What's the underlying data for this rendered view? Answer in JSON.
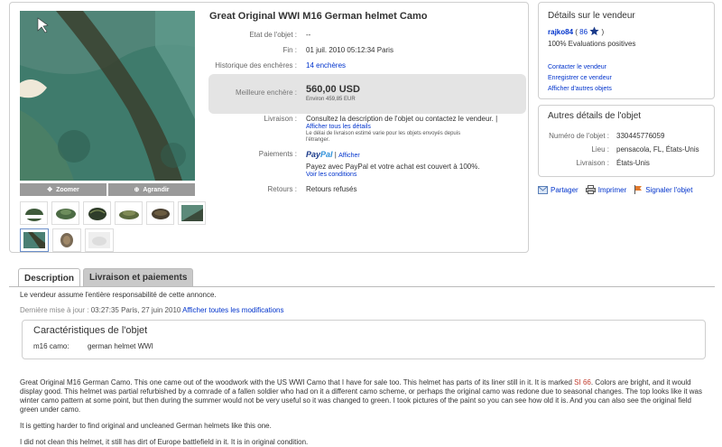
{
  "item": {
    "title": "Great Original WWI M16 German helmet Camo",
    "zoom_label": "Zoomer",
    "enlarge_label": "Agrandir",
    "condition_label": "Etat de l'objet :",
    "condition_value": "--",
    "end_label": "Fin :",
    "end_value": "01 juil. 2010 05:12:34 Paris",
    "history_label": "Historique des enchères :",
    "history_value": "14 enchères",
    "best_bid_label": "Meilleure enchère :",
    "best_bid_value": "560,00 USD",
    "best_bid_approx": "Environ 459,85 EUR",
    "delivery_label": "Livraison :",
    "delivery_value": "Consultez la description de l'objet ou contactez le vendeur.",
    "delivery_sep": "|",
    "delivery_link": "Afficher tous les détails",
    "delivery_note_1": "Le délai de livraison estimé varie pour les objets envoyés depuis",
    "delivery_note_2": "l'étranger.",
    "payments_label": "Paiements :",
    "paypal_part1": "Pay",
    "paypal_part2": "Pal",
    "paypal_sep": "|",
    "paypal_show": "Afficher",
    "paypal_text": "Payez avec PayPal et votre achat est couvert à 100%.",
    "paypal_conditions": "Voir les conditions",
    "returns_label": "Retours :",
    "returns_value": "Retours refusés"
  },
  "seller": {
    "title": "Détails sur le vendeur",
    "name": "rajko84",
    "open_paren": "(",
    "score": "86",
    "close_paren": ")",
    "positive": "100% Evaluations positives",
    "links": [
      "Contacter le vendeur",
      "Enregistrer ce vendeur",
      "Afficher d'autres objets"
    ]
  },
  "other": {
    "title": "Autres détails de l'objet",
    "rows": [
      {
        "label": "Numéro de l'objet :",
        "value": "330445776059"
      },
      {
        "label": "Lieu :",
        "value": "pensacola, FL, États-Unis"
      },
      {
        "label": "Livraison :",
        "value": "États-Unis"
      }
    ]
  },
  "actions": {
    "share": "Partager",
    "print": "Imprimer",
    "report": "Signaler l'objet"
  },
  "tabs": {
    "description": "Description",
    "delivery": "Livraison et paiements"
  },
  "description": {
    "responsibility": "Le vendeur assume l'entière responsabilité de cette annonce.",
    "last_update_label": "Dernière mise à jour :",
    "last_update_value": "03:27:35 Paris, 27 juin 2010",
    "show_changes": "Afficher toutes les modifications",
    "characteristics_title": "Caractéristiques de l'objet",
    "char_label": "m16 camo:",
    "char_value": "german helmet WWI",
    "para1_a": "Great Original M16 German Camo. This one came out of the woodwork with the US WWI Camo that I have for sale too. This helmet has parts of its liner still in it. It is marked ",
    "para1_red": "SI 66",
    "para1_b": ". Colors are bright, and it would display good. This helmet was partial refurbished by a comrade of a fallen soldier who had on it a different camo scheme, or perhaps the original camo was redone due to seasonal changes. The top looks like it was winter camo pattern at some point, but then during the summer would not be very useful so it was changed to green. I took pictures of the paint so you can see how old it is. And you can also see the original field green under camo.",
    "para2": "It is getting harder to find original and uncleaned German helmets like this one.",
    "para3": "I did not clean this helmet, it still has dirt of Europe battlefield in it. It is in original condition."
  },
  "colors": {
    "link": "#0033cc",
    "accent_red": "#c0392b",
    "star_blue": "#1a3a8a",
    "paypal_dark": "#1a3a8a",
    "paypal_light": "#2d8fd9"
  }
}
